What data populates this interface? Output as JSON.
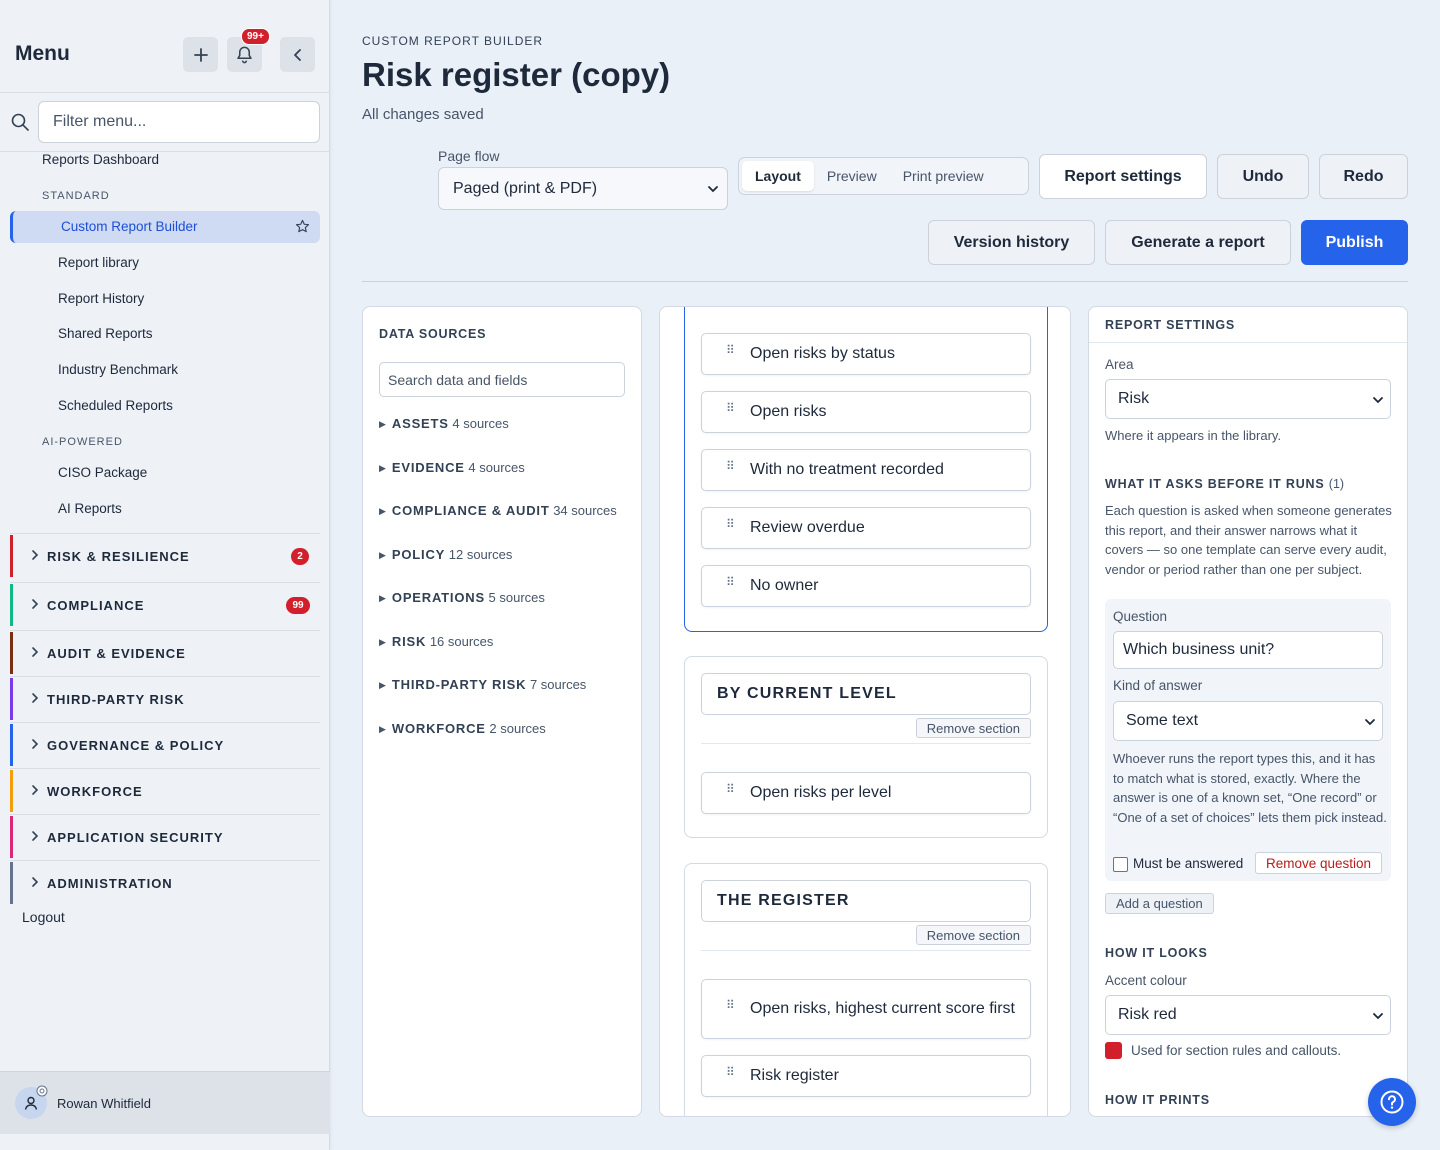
{
  "sidebar": {
    "title": "Menu",
    "notification_count": "99+",
    "filter_placeholder": "Filter menu...",
    "top_link": "Reports Dashboard",
    "standard_caption": "STANDARD",
    "active_item": "Custom Report Builder",
    "standard_items": [
      "Report library",
      "Report History",
      "Shared Reports",
      "Industry Benchmark",
      "Scheduled Reports"
    ],
    "ai_caption": "AI-POWERED",
    "ai_items": [
      "CISO Package",
      "AI Reports"
    ],
    "groups": [
      {
        "label": "RISK & RESILIENCE",
        "badge": "2",
        "color": "#d21f2c"
      },
      {
        "label": "COMPLIANCE",
        "badge": "99",
        "color": "#10b981"
      },
      {
        "label": "AUDIT & EVIDENCE",
        "badge": "",
        "color": "#7c2d12"
      },
      {
        "label": "THIRD-PARTY RISK",
        "badge": "",
        "color": "#7c3aed"
      },
      {
        "label": "GOVERNANCE & POLICY",
        "badge": "",
        "color": "#2563eb"
      },
      {
        "label": "WORKFORCE",
        "badge": "",
        "color": "#f59e0b"
      },
      {
        "label": "APPLICATION SECURITY",
        "badge": "",
        "color": "#db2777"
      },
      {
        "label": "ADMINISTRATION",
        "badge": "",
        "color": "#64748b"
      }
    ],
    "logout": "Logout",
    "user_name": "Rowan Whitfield"
  },
  "header": {
    "breadcrumb": "CUSTOM REPORT BUILDER",
    "title": "Risk register (copy)",
    "save_status": "All changes saved",
    "page_flow_label": "Page flow",
    "page_flow_value": "Paged (print & PDF)",
    "view_tabs": [
      "Layout",
      "Preview",
      "Print preview"
    ],
    "active_tab": "Layout",
    "report_settings": "Report settings",
    "undo": "Undo",
    "redo": "Redo",
    "version_history": "Version history",
    "generate": "Generate a report",
    "publish": "Publish"
  },
  "data_sources": {
    "title": "DATA SOURCES",
    "search_placeholder": "Search data and fields",
    "groups": [
      {
        "name": "ASSETS",
        "count": "4 sources"
      },
      {
        "name": "EVIDENCE",
        "count": "4 sources"
      },
      {
        "name": "COMPLIANCE & AUDIT",
        "count": "34 sources"
      },
      {
        "name": "POLICY",
        "count": "12 sources"
      },
      {
        "name": "OPERATIONS",
        "count": "5 sources"
      },
      {
        "name": "RISK",
        "count": "16 sources"
      },
      {
        "name": "THIRD-PARTY RISK",
        "count": "7 sources"
      },
      {
        "name": "WORKFORCE",
        "count": "2 sources"
      }
    ]
  },
  "canvas": {
    "first_section_items": [
      "Open risks by status",
      "Open risks",
      "With no treatment recorded",
      "Review overdue",
      "No owner"
    ],
    "remove_section": "Remove section",
    "section_current": {
      "title": "BY CURRENT LEVEL",
      "items": [
        "Open risks per level"
      ]
    },
    "section_register": {
      "title": "THE REGISTER",
      "items": [
        "Open risks, highest current score first",
        "Risk register"
      ]
    }
  },
  "settings": {
    "title": "REPORT SETTINGS",
    "area_label": "Area",
    "area_value": "Risk",
    "area_hint": "Where it appears in the library.",
    "asks_heading": "WHAT IT ASKS BEFORE IT RUNS",
    "asks_count": "(1)",
    "asks_hint": "Each question is asked when someone generates this report, and their answer narrows what it covers — so one template can serve every audit, vendor or period rather than one per subject.",
    "question_label": "Question",
    "question_value": "Which business unit?",
    "kind_label": "Kind of answer",
    "kind_value": "Some text",
    "kind_hint": "Whoever runs the report types this, and it has to match what is stored, exactly. Where the answer is one of a known set, “One record” or “One of a set of choices” lets them pick instead.",
    "required_label": "Must be answered",
    "remove_question": "Remove question",
    "add_question": "Add a question",
    "looks_heading": "HOW IT LOOKS",
    "accent_label": "Accent colour",
    "accent_value": "Risk red",
    "accent_color": "#d21f2c",
    "accent_hint": "Used for section rules and callouts.",
    "prints_heading": "HOW IT PRINTS"
  },
  "icons": {
    "add": "plus-icon",
    "notifications": "bell-icon",
    "collapse": "chevron-left-icon",
    "search": "search-icon",
    "favorite": "star-icon",
    "help": "help-icon"
  }
}
